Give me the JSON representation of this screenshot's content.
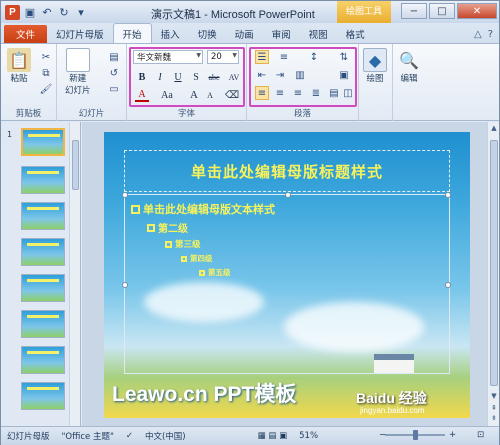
{
  "window": {
    "title": "演示文稿1 - Microsoft PowerPoint",
    "context_tab": "绘图工具",
    "controls": [
      "−",
      "□",
      "✕"
    ]
  },
  "tabs": [
    {
      "label": "文件"
    },
    {
      "label": "幻灯片母版"
    },
    {
      "label": "开始"
    },
    {
      "label": "插入"
    },
    {
      "label": "切换"
    },
    {
      "label": "动画"
    },
    {
      "label": "审阅"
    },
    {
      "label": "视图"
    },
    {
      "label": "格式"
    }
  ],
  "ribbon": {
    "clipboard": {
      "paste": "粘贴",
      "label": "剪贴板"
    },
    "slides": {
      "new_line1": "新建",
      "new_line2": "幻灯片",
      "label": "幻灯片"
    },
    "font": {
      "name": "华文新魏",
      "size": "20",
      "bold": "B",
      "italic": "I",
      "underline": "U",
      "strike": "S",
      "shadow": "abc",
      "spacing": "AV",
      "fontcolor": "A",
      "case": "Aa",
      "grow": "A",
      "shrink": "A",
      "label": "字体"
    },
    "paragraph": {
      "label": "段落"
    },
    "drawing": {
      "label": "绘图"
    },
    "editing": {
      "label": "编辑"
    }
  },
  "thumbnails": [
    "1"
  ],
  "slide": {
    "title": "单击此处编辑母版标题样式",
    "levels": [
      "单击此处编辑母版文本样式",
      "第二级",
      "第三级",
      "第四级",
      "第五级"
    ],
    "watermark": "Leawo.cn PPT模板",
    "baidu": "Baidu 经验",
    "baidu_sub": "jingyan.baidu.com"
  },
  "status": {
    "view": "幻灯片母版",
    "theme": "\"Office 主题\"",
    "lang": "中文(中国)",
    "zoom": "51%"
  },
  "colors": {
    "accent": "#d24726",
    "highlight": "#d04bbf",
    "title_text": "#f7f25c"
  }
}
